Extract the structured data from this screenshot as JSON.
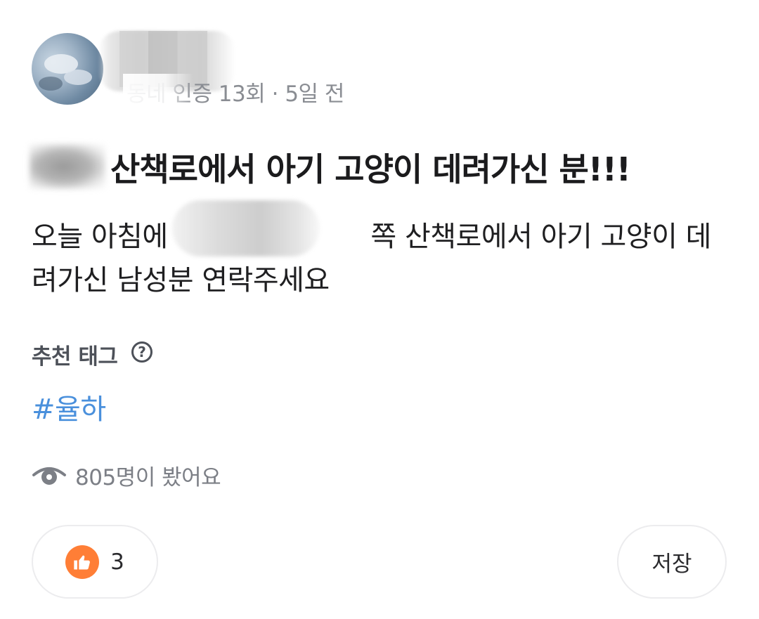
{
  "post": {
    "meta": "동네 인증 13회 · 5일 전",
    "title": "산책로에서 아기 고양이 데려가신 분!!!",
    "body": "오늘 아침에 　　　　　　　쪽 산책로에서 아기 고양이 데려가신 남성분 연락주세요"
  },
  "tags": {
    "label": "추천 태그",
    "help_icon": "?",
    "items": [
      "#율하"
    ]
  },
  "views": {
    "icon": "eye-icon",
    "text": "805명이 봤어요"
  },
  "actions": {
    "like_icon": "thumbs-up-icon",
    "like_count": "3",
    "save_label": "저장"
  },
  "colors": {
    "hashtag": "#4a90dc",
    "like_accent": "#ff7e36"
  }
}
